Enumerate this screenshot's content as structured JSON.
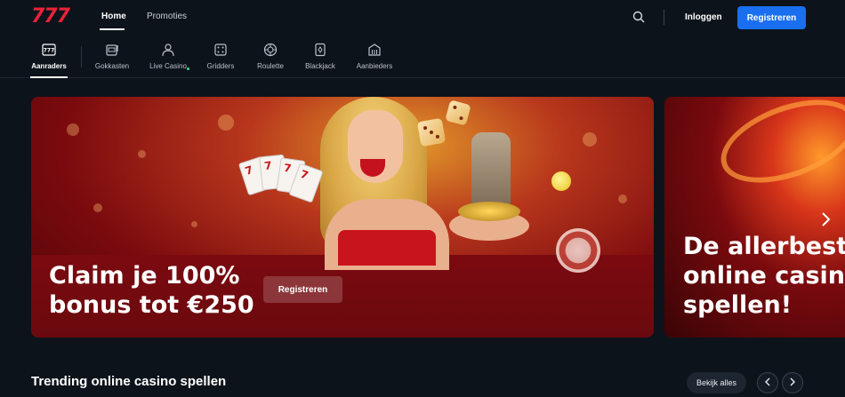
{
  "header": {
    "logo": "777",
    "nav": [
      {
        "label": "Home",
        "active": true
      },
      {
        "label": "Promoties",
        "active": false
      }
    ],
    "search_icon": "search-icon",
    "login_label": "Inloggen",
    "register_label": "Registreren",
    "accent_color": "#1a6ff0",
    "brand_color": "#e8223a"
  },
  "categories": [
    {
      "label": "Aanraders",
      "icon": "777-badge-icon",
      "active": true
    },
    {
      "label": "Gokkasten",
      "icon": "slot-machine-icon"
    },
    {
      "label": "Live Casino",
      "icon": "dealer-icon",
      "live_indicator": true
    },
    {
      "label": "Gridders",
      "icon": "dice-grid-icon"
    },
    {
      "label": "Roulette",
      "icon": "roulette-icon"
    },
    {
      "label": "Blackjack",
      "icon": "playing-card-icon"
    },
    {
      "label": "Aanbieders",
      "icon": "building-icon"
    }
  ],
  "hero": {
    "title": "Claim je 100% bonus tot €250",
    "cta_label": "Registreren"
  },
  "second_banner": {
    "title_lines": [
      "De allerbeste",
      "online casino",
      "spellen!"
    ],
    "next_icon": "chevron-right-icon"
  },
  "trending": {
    "title": "Trending online casino spellen",
    "see_all_label": "Bekijk alles",
    "prev_icon": "chevron-left-icon",
    "next_icon": "chevron-right-icon"
  }
}
